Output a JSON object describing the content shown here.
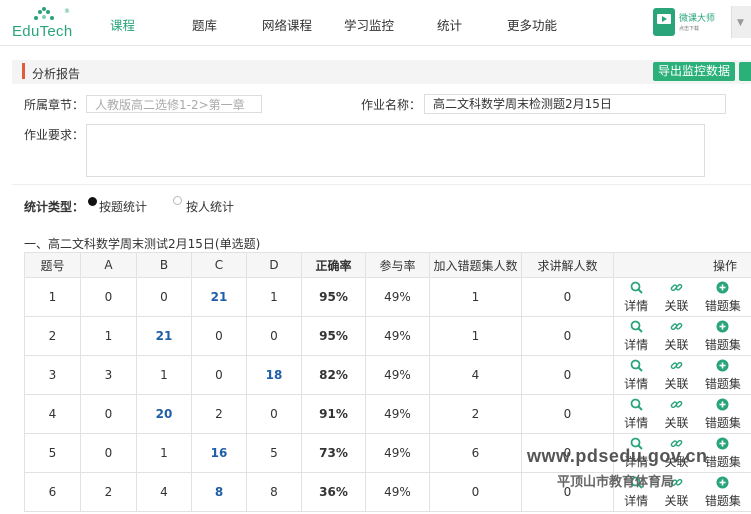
{
  "logo": {
    "brand": "EduTech",
    "reg": "®"
  },
  "nav": [
    {
      "label": "课程",
      "active": true
    },
    {
      "label": "题库",
      "active": false
    },
    {
      "label": "网络课程",
      "active": false
    },
    {
      "label": "学习监控",
      "active": false
    },
    {
      "label": "统计",
      "active": false
    },
    {
      "label": "更多功能",
      "active": false
    }
  ],
  "app_badge": {
    "name": "微课大师",
    "sub": "点击下载"
  },
  "section": {
    "title": "分析报告",
    "export_label": "导出监控数据"
  },
  "form": {
    "chapter_label": "所属章节：",
    "chapter_placeholder": "人教版高二选修1-2>第一章",
    "homework_label": "作业名称：",
    "homework_value": "高二文科数学周末检测题2月15日",
    "requirement_label": "作业要求："
  },
  "stat_type": {
    "label": "统计类型：",
    "options": [
      {
        "label": "按题统计",
        "selected": true
      },
      {
        "label": "按人统计",
        "selected": false
      }
    ]
  },
  "table_title": "一、高二文科数学周末测试2月15日(单选题)",
  "table": {
    "headers": [
      "题号",
      "A",
      "B",
      "C",
      "D",
      "正确率",
      "参与率",
      "加入错题集人数",
      "求讲解人数",
      "操作"
    ],
    "ops": [
      "详情",
      "关联",
      "错题集"
    ],
    "rows": [
      {
        "no": "1",
        "a": "0",
        "b": "0",
        "c": "21",
        "d": "1",
        "rate": "95%",
        "part": "49%",
        "err": "1",
        "req": "0",
        "correct": "c"
      },
      {
        "no": "2",
        "a": "1",
        "b": "21",
        "c": "0",
        "d": "0",
        "rate": "95%",
        "part": "49%",
        "err": "1",
        "req": "0",
        "correct": "b"
      },
      {
        "no": "3",
        "a": "3",
        "b": "1",
        "c": "0",
        "d": "18",
        "rate": "82%",
        "part": "49%",
        "err": "4",
        "req": "0",
        "correct": "d"
      },
      {
        "no": "4",
        "a": "0",
        "b": "20",
        "c": "2",
        "d": "0",
        "rate": "91%",
        "part": "49%",
        "err": "2",
        "req": "0",
        "correct": "b"
      },
      {
        "no": "5",
        "a": "0",
        "b": "1",
        "c": "16",
        "d": "5",
        "rate": "73%",
        "part": "49%",
        "err": "6",
        "req": "0",
        "correct": "c"
      },
      {
        "no": "6",
        "a": "2",
        "b": "4",
        "c": "8",
        "d": "8",
        "rate": "36%",
        "part": "49%",
        "err": "0",
        "req": "0",
        "correct": "c"
      }
    ]
  },
  "watermark": {
    "url": "www.pdsedu.gov.cn",
    "org": "平顶山市教育体育局"
  },
  "colors": {
    "accent": "#2aa57a",
    "highlight": "#1f5ea8",
    "section_bar": "#e65a3c"
  }
}
